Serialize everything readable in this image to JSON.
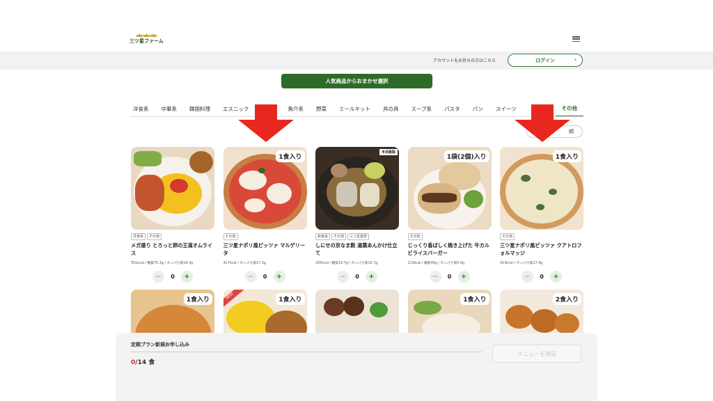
{
  "brand": {
    "logo_text": "三ツ星ファーム"
  },
  "account_bar": {
    "text": "アカウントをお持ちの方はこちら",
    "login_label": "ログイン",
    "login_chevron": "›"
  },
  "select_button": "人気商品からおまかせ選択",
  "tabs": [
    "洋食系",
    "中華系",
    "韓国料理",
    "エスニック",
    "魚介系",
    "野菜",
    "ミールキット",
    "丼の具",
    "スープ系",
    "パスタ",
    "パン",
    "スイーツ",
    "その他"
  ],
  "sort_label": "順",
  "cards": [
    {
      "tags": [
        "洋食系",
        "その他"
      ],
      "title": "メガ盛り とろっと卵の王道オムライス",
      "nutrition": "551kcal / 糖質70.3g / タンパク質16.4g",
      "qty": "0",
      "badge": "",
      "minus": "−",
      "plus": "+"
    },
    {
      "tags": [
        "その他"
      ],
      "title": "三ツ星ナポリ風ピッツァ マルゲリータ",
      "nutrition": "417kcal / タンパク質17.3g",
      "qty": "0",
      "badge": "1食入り",
      "minus": "−",
      "plus": "+"
    },
    {
      "tags": [
        "和食系",
        "その他",
        "三ツ星基準"
      ],
      "title": "しにせの京なま麩 湯葉あんかけ仕立て",
      "nutrition": "205kcal / 糖質19.7g / タンパク質16.7g",
      "qty": "0",
      "badge": "",
      "brand_mark": "半兵衛麸",
      "minus": "−",
      "plus": "+"
    },
    {
      "tags": [
        "その他"
      ],
      "title": "じっくり香ばしく焼き上げた 牛カルビライスバーガー",
      "nutrition": "213kcal / 糖質49g / タンパク質5.6g",
      "qty": "0",
      "badge": "1袋(2個)入り",
      "minus": "−",
      "plus": "+"
    },
    {
      "tags": [
        "その他"
      ],
      "title": "三ツ星ナポリ風ピッツァ クアトロフォルマッジ",
      "nutrition": "413kcal / タンパク質17.4g",
      "qty": "0",
      "badge": "1食入り",
      "minus": "−",
      "plus": "+"
    },
    {
      "badge": "1食入り"
    },
    {
      "badge": "1食入り",
      "ribbon": "NEW"
    },
    {
      "badge": ""
    },
    {
      "badge": "1食入り"
    },
    {
      "badge": "2食入り"
    }
  ],
  "footer": {
    "title": "定期プラン新規お申し込み",
    "count_current": "0",
    "count_total": "/14 食",
    "confirm_label": "メニューを確認"
  },
  "colors": {
    "accent": "#2e7d32",
    "button_green": "#2e6b28",
    "arrow_red": "#e8281e",
    "count_red": "#d32f2f"
  }
}
